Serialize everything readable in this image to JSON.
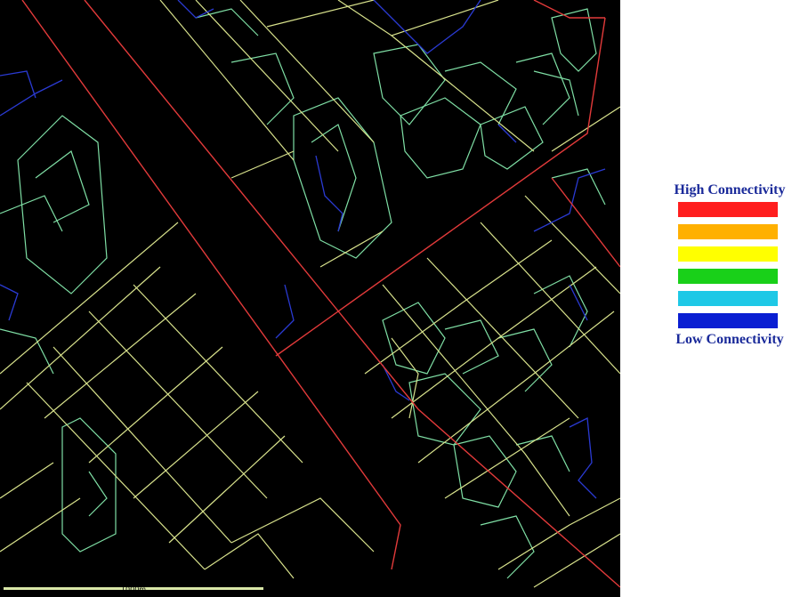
{
  "legend": {
    "high_label": "High Connectivity",
    "low_label": "Low Connectivity",
    "levels": [
      {
        "name": "high",
        "color": "#ff1e1e"
      },
      {
        "name": "medium-high",
        "color": "#ffb000"
      },
      {
        "name": "medium",
        "color": "#ffff00"
      },
      {
        "name": "medium-low",
        "color": "#19d019"
      },
      {
        "name": "low",
        "color": "#1ec8e6"
      },
      {
        "name": "lowest",
        "color": "#0a1ed2"
      }
    ]
  },
  "scale_bar": {
    "label": "1000m"
  },
  "map": {
    "background": "#000000"
  }
}
